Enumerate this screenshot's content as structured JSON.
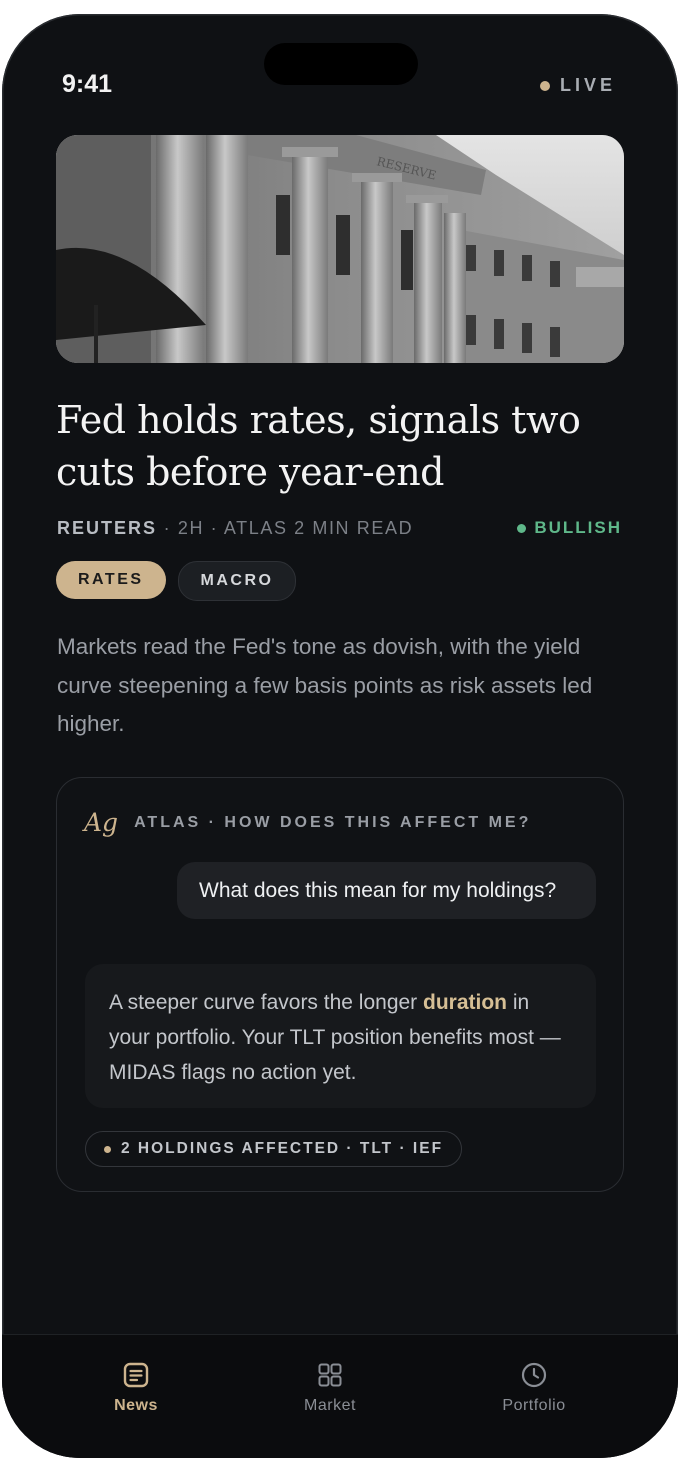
{
  "status_bar": {
    "time": "9:41",
    "live_label": "LIVE"
  },
  "article": {
    "headline": "Fed holds rates, signals two cuts before year-end",
    "source": "REUTERS",
    "age": "2H",
    "read_time": "ATLAS 2 MIN READ",
    "sentiment": "BULLISH",
    "tags": [
      "RATES",
      "MACRO"
    ],
    "summary": "Markets read the Fed's tone as dovish, with the yield curve steepening a few basis points as risk assets led higher."
  },
  "atlas_card": {
    "logo": "Ag",
    "title": "ATLAS · HOW DOES THIS AFFECT ME?",
    "question": "What does this mean for my holdings?",
    "answer_before": "A steeper curve favors the longer ",
    "answer_highlight": "duration",
    "answer_after": " in your portfolio. Your TLT position benefits most — MIDAS flags no action yet.",
    "affected": "2 HOLDINGS AFFECTED · TLT · IEF"
  },
  "tab_bar": {
    "items": [
      {
        "label": "News",
        "icon": "news-icon",
        "active": true
      },
      {
        "label": "Market",
        "icon": "grid-icon",
        "active": false
      },
      {
        "label": "Portfolio",
        "icon": "clock-icon",
        "active": false
      }
    ]
  },
  "colors": {
    "accent": "#cdb48e",
    "bullish": "#5fb88a",
    "background": "#0f1114"
  }
}
